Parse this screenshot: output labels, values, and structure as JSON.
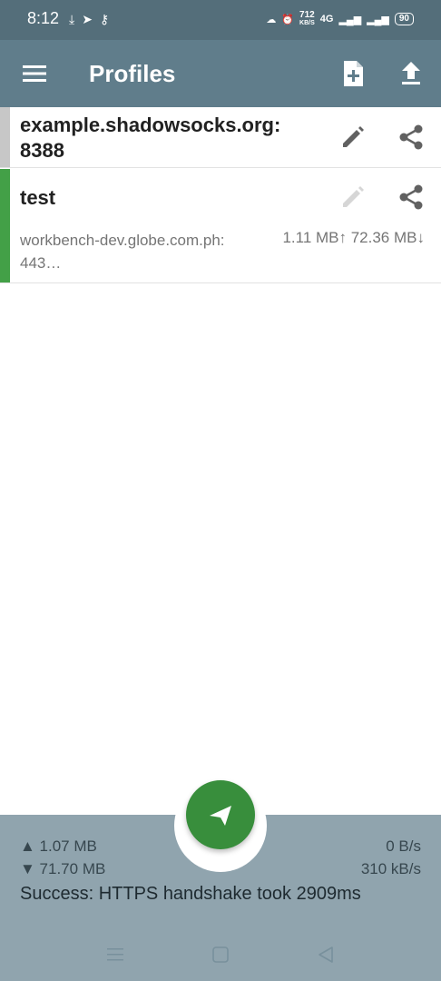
{
  "status_bar": {
    "time": "8:12",
    "speed_value": "712",
    "speed_unit": "KB/S",
    "network_tag": "4G",
    "battery": "90"
  },
  "app_bar": {
    "title": "Profiles"
  },
  "profiles": [
    {
      "name": "example.shadowsocks.org:\n8388",
      "active": false
    },
    {
      "name": "test",
      "server": "workbench-dev.globe.com.ph:\n443…",
      "traffic": "1.11 MB↑ 72.36 MB↓",
      "active": true
    }
  ],
  "stats": {
    "tx_total": "▲ 1.07 MB",
    "rx_total": "▼ 71.70 MB",
    "tx_rate": "0 B/s",
    "rx_rate": "310 kB/s",
    "message": "Success: HTTPS handshake took 2909ms"
  },
  "colors": {
    "primary": "#607d8b",
    "primary_dark": "#546e7a",
    "active_indicator": "#43a047",
    "fab": "#388e3c",
    "stats_background": "#90a4ae"
  },
  "icons": {
    "menu": "menu-icon",
    "add_profile": "add-profile-icon",
    "import": "import-icon",
    "edit": "edit-icon",
    "share": "share-icon",
    "connect": "send-icon"
  }
}
